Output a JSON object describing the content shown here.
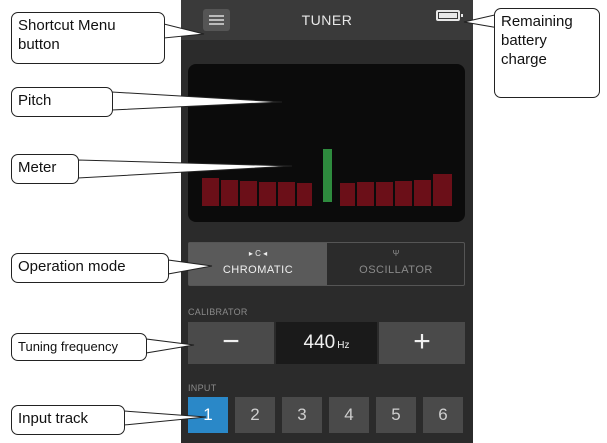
{
  "app": {
    "title": "TUNER"
  },
  "operation_modes": [
    {
      "icon": "chromatic-icon",
      "label": "CHROMATIC",
      "active": true
    },
    {
      "icon": "oscillator-icon",
      "label": "OSCILLATOR",
      "active": false
    }
  ],
  "calibrator": {
    "section_label": "CALIBRATOR",
    "minus_label": "−",
    "plus_label": "+",
    "value": "440",
    "unit": "Hz"
  },
  "input": {
    "section_label": "INPUT",
    "tracks": [
      "1",
      "2",
      "3",
      "4",
      "5",
      "6"
    ],
    "selected": "1"
  },
  "callouts": {
    "shortcut_menu": "Shortcut Menu button",
    "battery": "Remaining battery charge",
    "pitch": "Pitch",
    "meter": "Meter",
    "operation_mode": "Operation mode",
    "tuning_frequency": "Tuning frequency",
    "input_track": "Input track"
  },
  "colors": {
    "accent": "#2a88c8",
    "meter_inactive": "#6b0f18",
    "needle": "#2e8b3e"
  }
}
